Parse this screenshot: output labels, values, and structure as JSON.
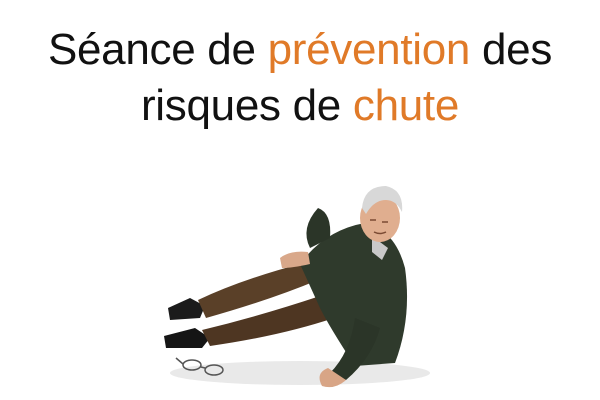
{
  "slide": {
    "title": {
      "line1_part1": "Séance de ",
      "line1_accent": "prévention",
      "line1_part2": " des",
      "line2_part1": "risques de ",
      "line2_accent": "chute"
    },
    "accent_color": "#e07a28",
    "text_color": "#111111",
    "image": {
      "icon": "elderly-man-fallen-photo"
    }
  }
}
